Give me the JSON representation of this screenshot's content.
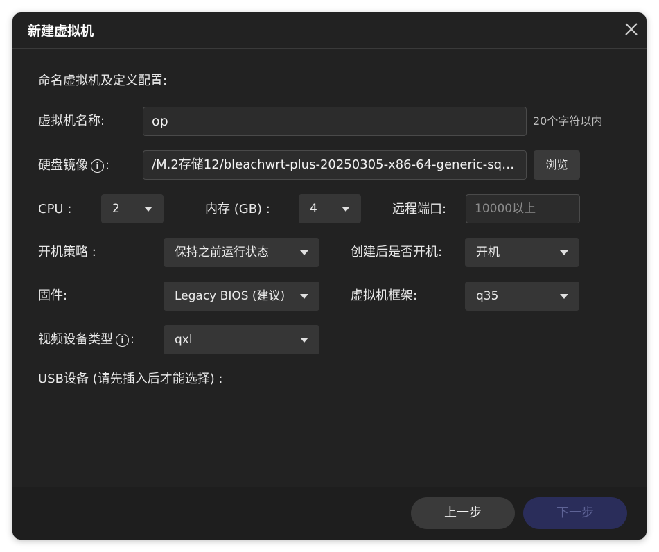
{
  "dialog": {
    "title": "新建虚拟机",
    "section_label": "命名虚拟机及定义配置:"
  },
  "form": {
    "name": {
      "label": "虚拟机名称:",
      "value": "op",
      "hint": "20个字符以内"
    },
    "disk_image": {
      "label": "硬盘镜像",
      "info_glyph": "i",
      "colon": ":",
      "value": "/M.2存储12/bleachwrt-plus-20250305-x86-64-generic-squ···",
      "browse_label": "浏览"
    },
    "cpu": {
      "label": "CPU :",
      "value": "2"
    },
    "memory": {
      "label": "内存 (GB) :",
      "value": "4"
    },
    "remote_port": {
      "label": "远程端口:",
      "placeholder": "10000以上"
    },
    "boot_policy": {
      "label": "开机策略 :",
      "value": "保持之前运行状态"
    },
    "power_on_after_create": {
      "label": "创建后是否开机:",
      "value": "开机"
    },
    "firmware": {
      "label": "固件:",
      "value": "Legacy BIOS (建议)"
    },
    "machine_type": {
      "label": "虚拟机框架:",
      "value": "q35"
    },
    "video_device": {
      "label": "视频设备类型",
      "info_glyph": "i",
      "colon": ":",
      "value": "qxl"
    },
    "usb": {
      "label": "USB设备 (请先插入后才能选择) :"
    }
  },
  "footer": {
    "prev_label": "上一步",
    "next_label": "下一步"
  },
  "colors": {
    "dialog_bg": "#222222",
    "input_bg": "#2c2c2c",
    "select_bg": "#363636",
    "next_button_bg": "#2a2d5a"
  },
  "icons": {
    "close": "close-icon",
    "info": "info-icon",
    "caret": "chevron-down-icon"
  }
}
